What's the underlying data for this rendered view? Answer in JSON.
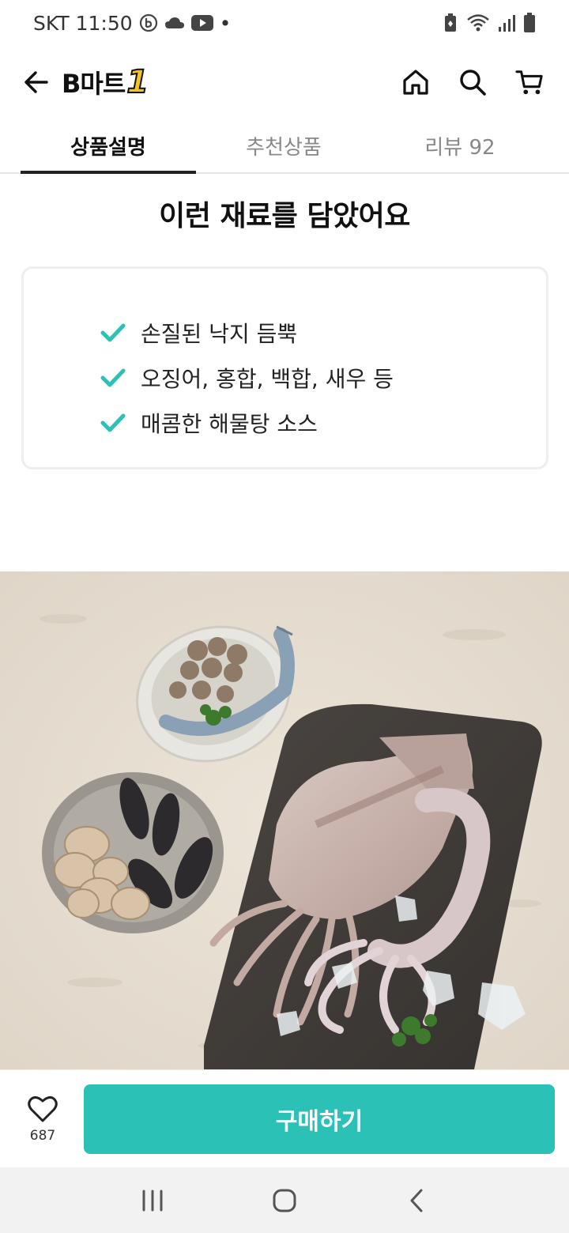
{
  "status_bar": {
    "carrier": "SKT",
    "time": "11:50",
    "dot": "•",
    "icons": [
      "b-app-icon",
      "cloud-icon",
      "youtube-icon",
      "battery-saver-icon",
      "wifi-icon",
      "signal-icon",
      "battery-icon"
    ]
  },
  "header": {
    "logo_text": "B마트",
    "logo_number": "1",
    "actions": [
      "home-icon",
      "search-icon",
      "cart-icon"
    ]
  },
  "tabs": [
    {
      "label": "상품설명",
      "active": true
    },
    {
      "label": "추천상품",
      "active": false
    },
    {
      "label": "리뷰 92",
      "active": false
    }
  ],
  "section": {
    "title": "이런 재료를 담았어요",
    "ingredients": [
      "손질된 낙지 듬뿍",
      "오징어, 홍합, 백합, 새우 등",
      "매콤한 해물탕 소스"
    ]
  },
  "colors": {
    "accent": "#2cc1b7",
    "check": "#2cc1b7",
    "logo_yellow": "#f6c51b"
  },
  "purchase": {
    "like_count": "687",
    "buy_label": "구매하기"
  },
  "nav": [
    "recent-apps-icon",
    "home-nav-icon",
    "back-nav-icon"
  ]
}
